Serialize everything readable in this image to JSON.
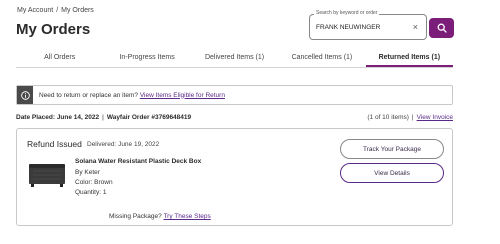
{
  "breadcrumb": {
    "items": [
      "My Account",
      "My Orders"
    ],
    "separator": "/"
  },
  "page_title": "My Orders",
  "search": {
    "label": "Search by keyword or order",
    "value": "FRANK NEUWINGER",
    "clear_symbol": "×",
    "button_icon": "search-icon",
    "button_color": "#7b1e7a"
  },
  "tabs": [
    {
      "label": "All Orders",
      "active": false
    },
    {
      "label": "In-Progress Items",
      "active": false
    },
    {
      "label": "Delivered Items (1)",
      "active": false
    },
    {
      "label": "Cancelled Items (1)",
      "active": false
    },
    {
      "label": "Returned Items (1)",
      "active": true
    }
  ],
  "notice": {
    "icon": "info-icon",
    "text": "Need to return or replace an item?",
    "link": "View Items Eligible for Return"
  },
  "order": {
    "date_placed": "Date Placed: June 14, 2022",
    "separator": "|",
    "order_number": "Wayfair Order #3769648419",
    "item_count": "(1 of 10 items)",
    "view_invoice": "View Invoice"
  },
  "item": {
    "status": "Refund Issued",
    "status_date": "Delivered: June 19, 2022",
    "name": "Solana Water Resistant Plastic Deck Box",
    "brand": "By Keter",
    "color": "Color: Brown",
    "quantity": "Quantity: 1",
    "track_button": "Track Your Package",
    "view_button": "View Details",
    "missing_text": "Missing Package?",
    "missing_link": "Try These Steps"
  },
  "colors": {
    "accent": "#7b1e7a",
    "link": "#5a2a8a"
  }
}
